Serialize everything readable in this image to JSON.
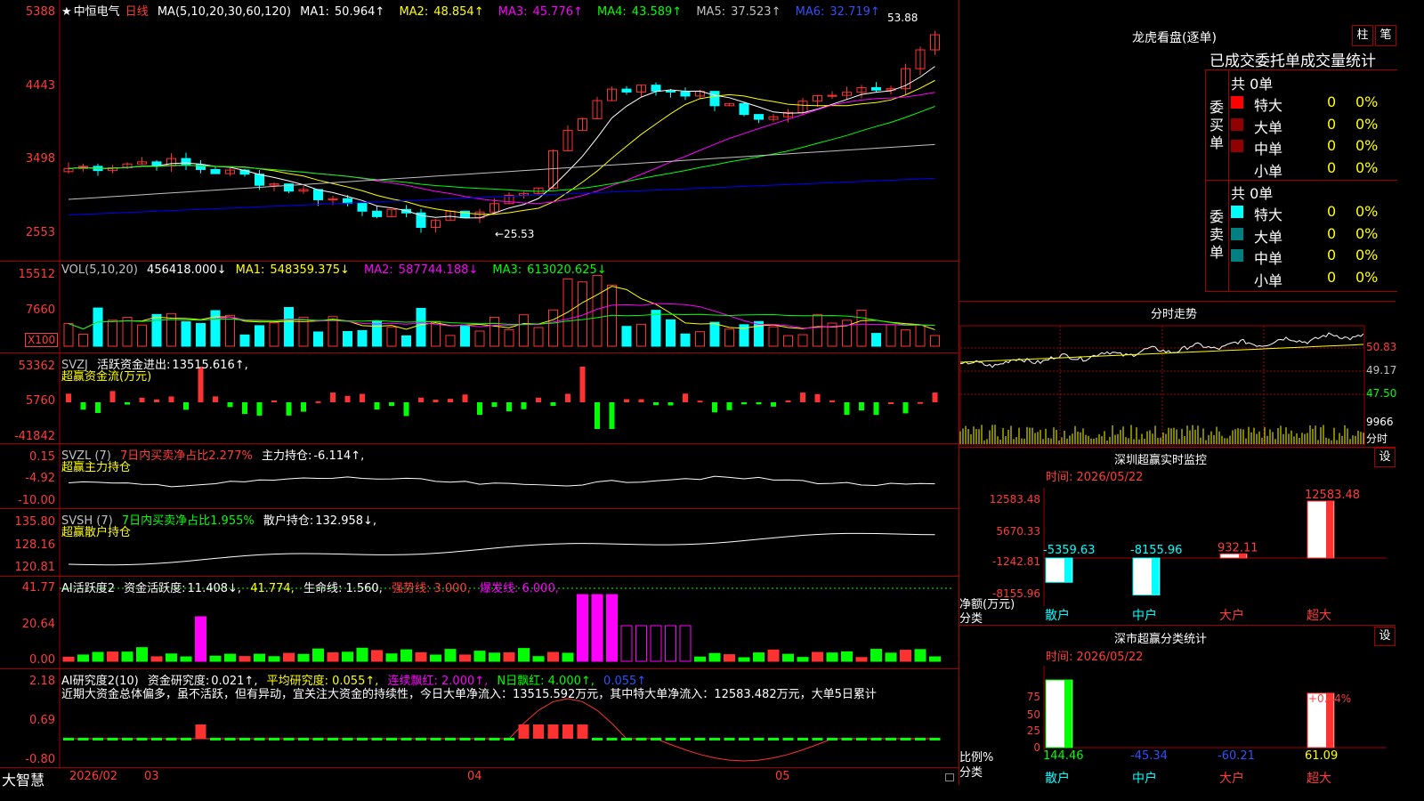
{
  "stock": {
    "star": "★",
    "name": "中恒电气",
    "period": "日线"
  },
  "colors": {
    "up": "#ff3232",
    "down": "#00ffff",
    "ma1": "#ffffff",
    "ma2": "#ffff00",
    "ma3": "#ff00ff",
    "ma4": "#00ff00",
    "ma5": "#c0c0c0",
    "ma6": "#0000ff",
    "grid": "#a00000",
    "green": "#00ff00",
    "axisred": "#ff3c3c"
  },
  "main": {
    "ma_label": "MA(5,10,20,30,60,120)",
    "ma": [
      {
        "label": "MA1:",
        "value": "50.964↑"
      },
      {
        "label": "MA2:",
        "value": "48.854↑"
      },
      {
        "label": "MA3:",
        "value": "45.776↑"
      },
      {
        "label": "MA4:",
        "value": "43.589↑"
      },
      {
        "label": "MA5:",
        "value": "37.523↑"
      },
      {
        "label": "MA6:",
        "value": "32.719↑"
      }
    ],
    "yticks": [
      "5388",
      "4443",
      "3498",
      "2553"
    ],
    "high_note": "53.88",
    "low_note": "←25.53"
  },
  "vol": {
    "title": "VOL(5,10,20)",
    "value": "456418.000↓",
    "ma": [
      {
        "label": "MA1:",
        "value": "548359.375↓"
      },
      {
        "label": "MA2:",
        "value": "587744.188↓"
      },
      {
        "label": "MA3:",
        "value": "613020.625↓"
      }
    ],
    "yticks": [
      "15512",
      "7660"
    ],
    "unit": "X100"
  },
  "svzj": {
    "title": "SVZJ",
    "label": "活跃资金进出:",
    "value": "13515.616↑,",
    "sub": "超赢资金流(万元)",
    "yticks": [
      "53362",
      "5760",
      "-41842"
    ]
  },
  "svzl": {
    "title": "SVZL (7)",
    "pct": "7日内买卖净占比2.277%",
    "label": "主力持仓:",
    "value": "-6.114↑,",
    "sub": "超赢主力持仓",
    "yticks": [
      "0.15",
      "-4.92",
      "-10.00"
    ]
  },
  "svsh": {
    "title": "SVSH (7)",
    "pct": "7日内买卖净占比1.955%",
    "label": "散户持仓:",
    "value": "132.958↓,",
    "sub": "超赢散户持仓",
    "yticks": [
      "135.80",
      "128.16",
      "120.81"
    ]
  },
  "ai1": {
    "title": "AI活跃度2",
    "label": "资金活跃度:",
    "value": "11.408↓,",
    "v2": "41.774,",
    "life": "生命线: 1.560,",
    "strong": "强势线: 3.000,",
    "burst": "爆发线: 6.000,",
    "yticks": [
      "41.77",
      "20.64",
      "0.00"
    ]
  },
  "ai2": {
    "title": "AI研究度2(10)",
    "label": "资金研究度:",
    "value": "0.021↑,",
    "avg": "平均研究度: 0.055↑,",
    "cont": "连续飘红: 2.000↑,",
    "n": "N日飘红: 4.000↑,",
    "last": "0.055↑",
    "comment": "近期大资金总体偏多，虽不活跃，但有异动，宜关注大资金的持续性，今日大单净流入：13515.592万元，其中特大单净流入：12583.482万元，大单5日累计",
    "yticks": [
      "2.18",
      "0.69",
      "-0.80"
    ]
  },
  "xaxis": {
    "brand": "大智慧",
    "labels": [
      "2026/02",
      "03",
      "04",
      "05"
    ]
  },
  "dragon": {
    "title": "龙虎看盘(逐单)",
    "btn1": "柱",
    "btn2": "笔",
    "header": "已成交委托单成交量统计",
    "buy_total": "共 0单",
    "sell_total": "共 0单",
    "buy_label": "委买单",
    "sell_label": "委卖单",
    "buy": [
      {
        "name": "特大",
        "count": "0",
        "pct": "0%"
      },
      {
        "name": "大单",
        "count": "0",
        "pct": "0%"
      },
      {
        "name": "中单",
        "count": "0",
        "pct": "0%"
      },
      {
        "name": "小单",
        "count": "0",
        "pct": "0%"
      }
    ],
    "sell": [
      {
        "name": "特大",
        "count": "0",
        "pct": "0%"
      },
      {
        "name": "大单",
        "count": "0",
        "pct": "0%"
      },
      {
        "name": "中单",
        "count": "0",
        "pct": "0%"
      },
      {
        "name": "小单",
        "count": "0",
        "pct": "0%"
      }
    ]
  },
  "intraday": {
    "title": "分时走势",
    "yticks": [
      "50.83",
      "49.17",
      "47.50"
    ],
    "vol": "9966",
    "foot": "分时"
  },
  "monitor": {
    "title": "深圳超赢实时监控",
    "set": "设",
    "time": "时间: 2026/05/22",
    "yticks": [
      "12583.48",
      "5670.33",
      "-1242.81",
      "-8155.96"
    ],
    "ylabel": "净额(万元)",
    "xlabel": "分类",
    "bars": [
      {
        "cat": "散户",
        "value": -5359.63,
        "label": "-5359.63"
      },
      {
        "cat": "中户",
        "value": -8155.96,
        "label": "-8155.96"
      },
      {
        "cat": "大户",
        "value": 932.11,
        "label": "932.11"
      },
      {
        "cat": "超大",
        "value": 12583.48,
        "label": "12583.48"
      }
    ]
  },
  "classify": {
    "title": "深市超赢分类统计",
    "set": "设",
    "time": "时间: 2026/05/22",
    "yticks": [
      "75",
      "50",
      "25",
      "0"
    ],
    "ylabel": "比例%",
    "xlabel": "分类",
    "top_label": "+0.44%",
    "bars": [
      {
        "cat": "散户",
        "value": 144.46,
        "label": "144.46"
      },
      {
        "cat": "中户",
        "value": -45.34,
        "label": "-45.34"
      },
      {
        "cat": "大户",
        "value": -60.21,
        "label": "-60.21"
      },
      {
        "cat": "超大",
        "value": 61.09,
        "label": "61.09"
      }
    ]
  }
}
